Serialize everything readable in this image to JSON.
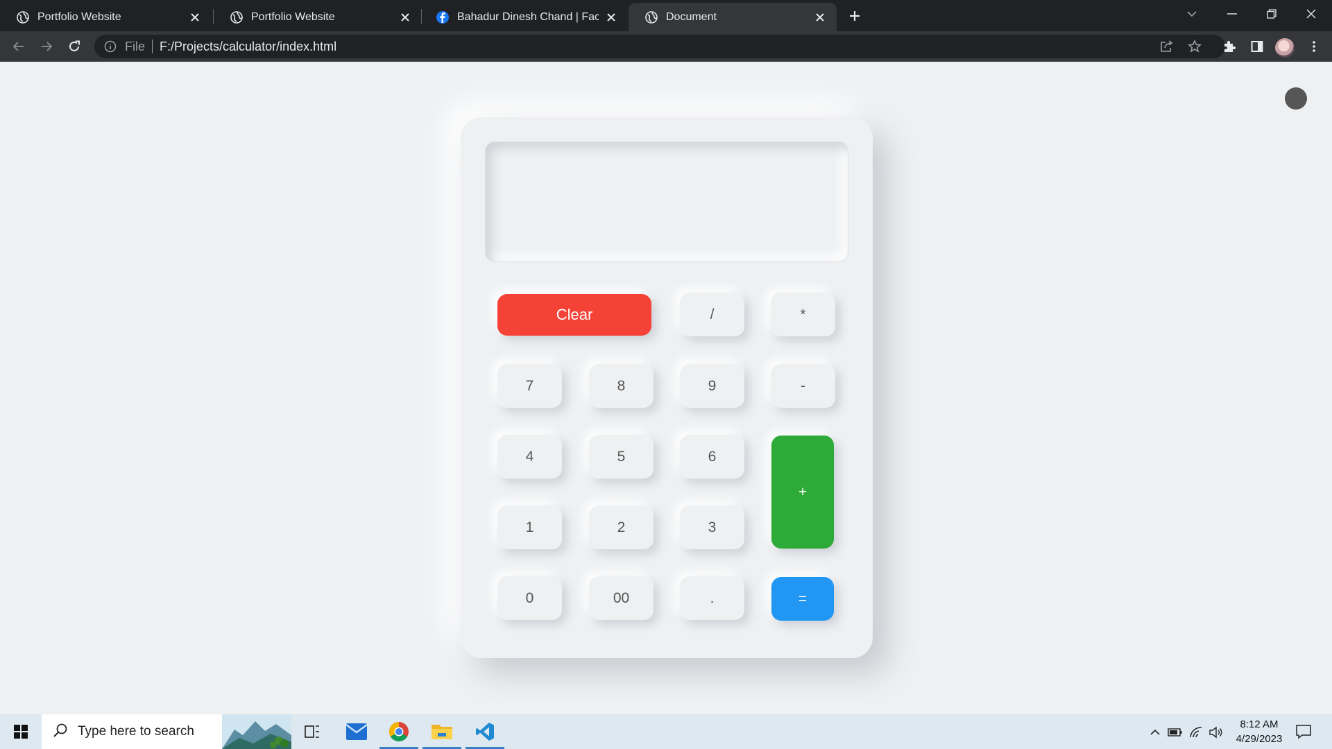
{
  "browser": {
    "tabs": [
      {
        "title": "Portfolio Website",
        "icon": "globe-icon",
        "active": false
      },
      {
        "title": "Portfolio Website",
        "icon": "globe-icon",
        "active": false
      },
      {
        "title": "Bahadur Dinesh Chand | Faceboo",
        "icon": "facebook-icon",
        "active": false
      },
      {
        "title": "Document",
        "icon": "globe-icon",
        "active": true
      }
    ],
    "address": {
      "protocol_label": "File",
      "url": "F:/Projects/calculator/index.html"
    }
  },
  "calculator": {
    "display_value": "",
    "keys": {
      "clear": "Clear",
      "divide": "/",
      "multiply": "*",
      "seven": "7",
      "eight": "8",
      "nine": "9",
      "minus": "-",
      "four": "4",
      "five": "5",
      "six": "6",
      "plus": "+",
      "one": "1",
      "two": "2",
      "three": "3",
      "zero": "0",
      "double_zero": "00",
      "dot": ".",
      "equals": "="
    },
    "colors": {
      "clear": "#f44336",
      "plus": "#2eaa38",
      "equals": "#2196f3"
    }
  },
  "taskbar": {
    "search_placeholder": "Type here to search",
    "time": "8:12 AM",
    "date": "4/29/2023"
  }
}
